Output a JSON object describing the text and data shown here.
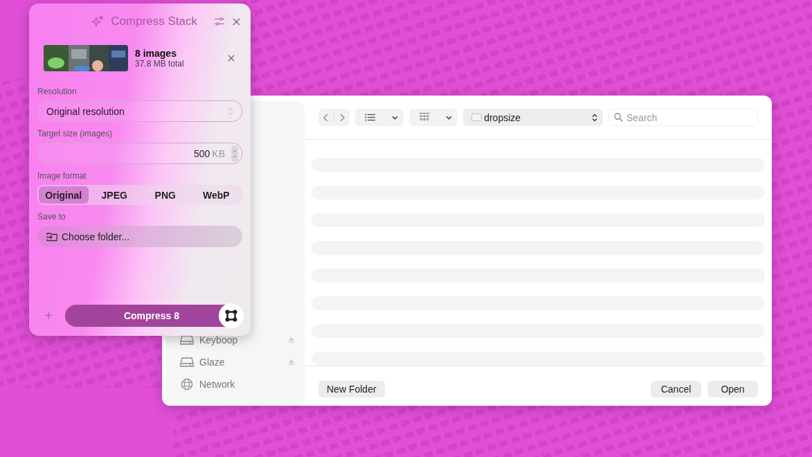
{
  "dialog": {
    "location": "dropsize",
    "search": {
      "placeholder": "Search"
    },
    "sidebar": [
      {
        "label": "Keyboop",
        "kind": "drive",
        "ejectable": true
      },
      {
        "label": "Glaze",
        "kind": "drive",
        "ejectable": true
      },
      {
        "label": "Network",
        "kind": "network",
        "ejectable": false
      }
    ],
    "new_folder_button": "New Folder",
    "cancel_button": "Cancel",
    "open_button": "Open"
  },
  "panel": {
    "title": "Compress Stack",
    "stack": {
      "count_label": "8 images",
      "size_label": "37.8 MB total"
    },
    "resolution": {
      "label": "Resolution",
      "value": "Original resolution"
    },
    "target_size": {
      "label": "Target size (images)",
      "value": "500",
      "unit": "KB"
    },
    "image_format": {
      "label": "Image format",
      "options": [
        {
          "label": "Original",
          "selected": true
        },
        {
          "label": "JPEG",
          "selected": false
        },
        {
          "label": "PNG",
          "selected": false
        },
        {
          "label": "WebP",
          "selected": false
        }
      ]
    },
    "save_to": {
      "label": "Save to",
      "button": "Choose folder..."
    },
    "add_button": "+",
    "compress_button": "Compress 8"
  }
}
